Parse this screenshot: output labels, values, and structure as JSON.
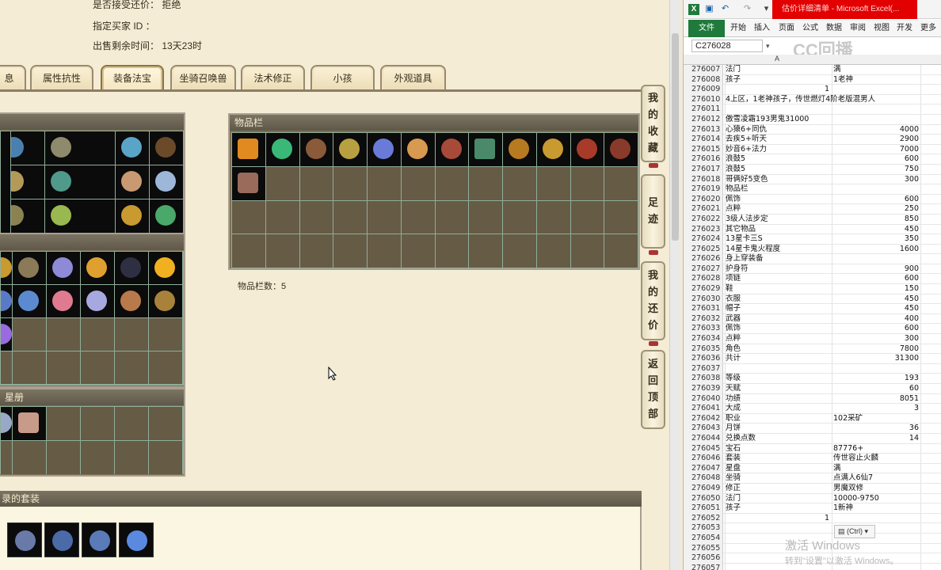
{
  "info": {
    "counter_offer": "是否接受还价： 拒绝",
    "buyer_id": "指定买家 ID ：",
    "remaining": "出售剩余时间： 13天23时"
  },
  "tabs": [
    "息",
    "属性抗性",
    "装备法宝",
    "坐骑召唤兽",
    "法术修正",
    "小孩",
    "外观道具"
  ],
  "active_tab": "装备法宝",
  "inventory": {
    "title": "物品栏",
    "count_label": "物品栏数：5"
  },
  "sections": {
    "star": "星册",
    "suits": "录的套装"
  },
  "side_buttons": [
    "我的收藏",
    "足迹",
    "我的还价",
    "返回顶部"
  ],
  "excel": {
    "title": "估价详细清单 - Microsoft Excel(...",
    "name_box": "C276028",
    "col_a": "A",
    "ribbon": [
      "文件",
      "开始",
      "插入",
      "页面",
      "公式",
      "数据",
      "审阅",
      "视图",
      "开发",
      "更多"
    ],
    "watermark": "CC回播",
    "activate": "激活 Windows",
    "activate_sub": "转到\"设置\"以激活 Windows。",
    "paste": "(Ctrl)",
    "rows": [
      {
        "n": "276007",
        "a": "法门",
        "b": "满"
      },
      {
        "n": "276008",
        "a": "孩子",
        "b": "1老神"
      },
      {
        "n": "276009",
        "a": "",
        "v": "1",
        "vpos": "mid"
      },
      {
        "n": "276010",
        "a": "4上区，1老神孩子，传世燃灯4阶老版混男人"
      },
      {
        "n": "276011",
        "a": ""
      },
      {
        "n": "276012",
        "a": "傲雪凌霜193男鬼31000"
      },
      {
        "n": "276013",
        "a": "心猿6+同仇",
        "v": "4000"
      },
      {
        "n": "276014",
        "a": "去疾5+听天",
        "v": "2900"
      },
      {
        "n": "276015",
        "a": "妙音6+法力",
        "v": "7000"
      },
      {
        "n": "276016",
        "a": "浪鼓5",
        "v": "600"
      },
      {
        "n": "276017",
        "a": "浪鼓5",
        "v": "750"
      },
      {
        "n": "276018",
        "a": "哥俩好5变色",
        "v": "300"
      },
      {
        "n": "276019",
        "a": "物品栏"
      },
      {
        "n": "276020",
        "a": "佩饰",
        "v": "600"
      },
      {
        "n": "276021",
        "a": "点粹",
        "v": "250"
      },
      {
        "n": "276022",
        "a": "3级人法步定",
        "v": "850"
      },
      {
        "n": "276023",
        "a": "其它物品",
        "v": "450"
      },
      {
        "n": "276024",
        "a": "13星卡三S",
        "v": "350"
      },
      {
        "n": "276025",
        "a": "14星卡鬼火程度",
        "v": "1600"
      },
      {
        "n": "276026",
        "a": "身上穿装备"
      },
      {
        "n": "276027",
        "a": "护身符",
        "v": "900"
      },
      {
        "n": "276028",
        "a": "项链",
        "v": "600"
      },
      {
        "n": "276029",
        "a": "鞋",
        "v": "150"
      },
      {
        "n": "276030",
        "a": "衣服",
        "v": "450"
      },
      {
        "n": "276031",
        "a": "帽子",
        "v": "450"
      },
      {
        "n": "276032",
        "a": "武器",
        "v": "400"
      },
      {
        "n": "276033",
        "a": "佩饰",
        "v": "600"
      },
      {
        "n": "276034",
        "a": "点粹",
        "v": "300"
      },
      {
        "n": "276035",
        "a": "角色",
        "v": "7800"
      },
      {
        "n": "276036",
        "a": "共计",
        "v": "31300"
      },
      {
        "n": "276037",
        "a": ""
      },
      {
        "n": "276038",
        "a": "等级",
        "v": "193"
      },
      {
        "n": "276039",
        "a": "天赋",
        "v": "60"
      },
      {
        "n": "276040",
        "a": "功绩",
        "v": "8051"
      },
      {
        "n": "276041",
        "a": "大成",
        "v": "3"
      },
      {
        "n": "276042",
        "a": "职业",
        "b": "102采矿"
      },
      {
        "n": "276043",
        "a": "月饼",
        "v": "36"
      },
      {
        "n": "276044",
        "a": "兑换点数",
        "v": "14"
      },
      {
        "n": "276045",
        "a": "宝石",
        "b": "87776+"
      },
      {
        "n": "276046",
        "a": "套装",
        "b": "传世容止火麟"
      },
      {
        "n": "276047",
        "a": "星盘",
        "b": "满"
      },
      {
        "n": "276048",
        "a": "坐骑",
        "b": "点满人6仙7"
      },
      {
        "n": "276049",
        "a": "修正",
        "b": "男魔双修"
      },
      {
        "n": "276050",
        "a": "法门",
        "b": "10000-9750"
      },
      {
        "n": "276051",
        "a": "孩子",
        "b": "1新神"
      },
      {
        "n": "276052",
        "a": "",
        "v": "1",
        "vpos": "mid"
      },
      {
        "n": "276053",
        "a": ""
      },
      {
        "n": "276054",
        "a": ""
      },
      {
        "n": "276055",
        "a": ""
      },
      {
        "n": "276056",
        "a": ""
      },
      {
        "n": "276057",
        "a": ""
      }
    ]
  },
  "colors": {
    "panel": "#7b7053",
    "cell": "#665b45",
    "grid": "#8fae9a",
    "tab": "#f0e2bf",
    "excel_red": "#e20000",
    "excel_green": "#1f7a3b"
  }
}
